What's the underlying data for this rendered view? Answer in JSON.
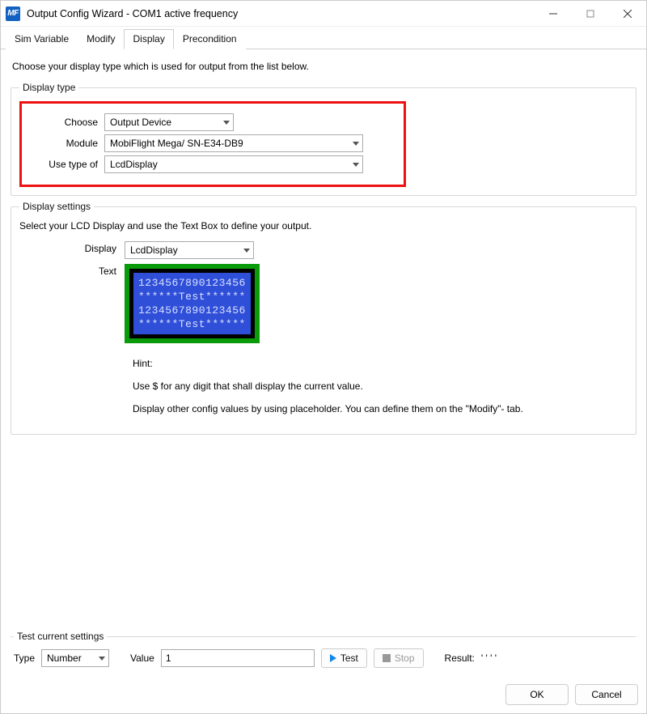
{
  "window": {
    "title": "Output Config Wizard - COM1 active frequency",
    "app_abbr": "MF"
  },
  "tabs": [
    "Sim Variable",
    "Modify",
    "Display",
    "Precondition"
  ],
  "active_tab_index": 2,
  "instruction": "Choose your display type which is used for output from the list below.",
  "display_type": {
    "legend": "Display type",
    "choose_label": "Choose",
    "choose_value": "Output Device",
    "module_label": "Module",
    "module_value": "MobiFlight Mega/ SN-E34-DB9",
    "usetype_label": "Use type of",
    "usetype_value": "LcdDisplay"
  },
  "display_settings": {
    "legend": "Display settings",
    "intro": "Select your LCD Display and use the Text Box to define your output.",
    "display_label": "Display",
    "display_value": "LcdDisplay",
    "text_label": "Text",
    "lcd_lines": [
      "1234567890123456",
      "******Test******",
      "1234567890123456",
      "******Test******"
    ],
    "hint_title": "Hint:",
    "hint_line1": "Use $ for any digit that shall display the current value.",
    "hint_line2": "Display other config values by using placeholder. You can define them on the \"Modify\"- tab."
  },
  "test": {
    "legend": "Test current settings",
    "type_label": "Type",
    "type_value": "Number",
    "value_label": "Value",
    "value_value": "1",
    "test_btn": "Test",
    "stop_btn": "Stop",
    "result_label": "Result:",
    "result_value": "' ' ' '"
  },
  "dialog": {
    "ok": "OK",
    "cancel": "Cancel"
  }
}
